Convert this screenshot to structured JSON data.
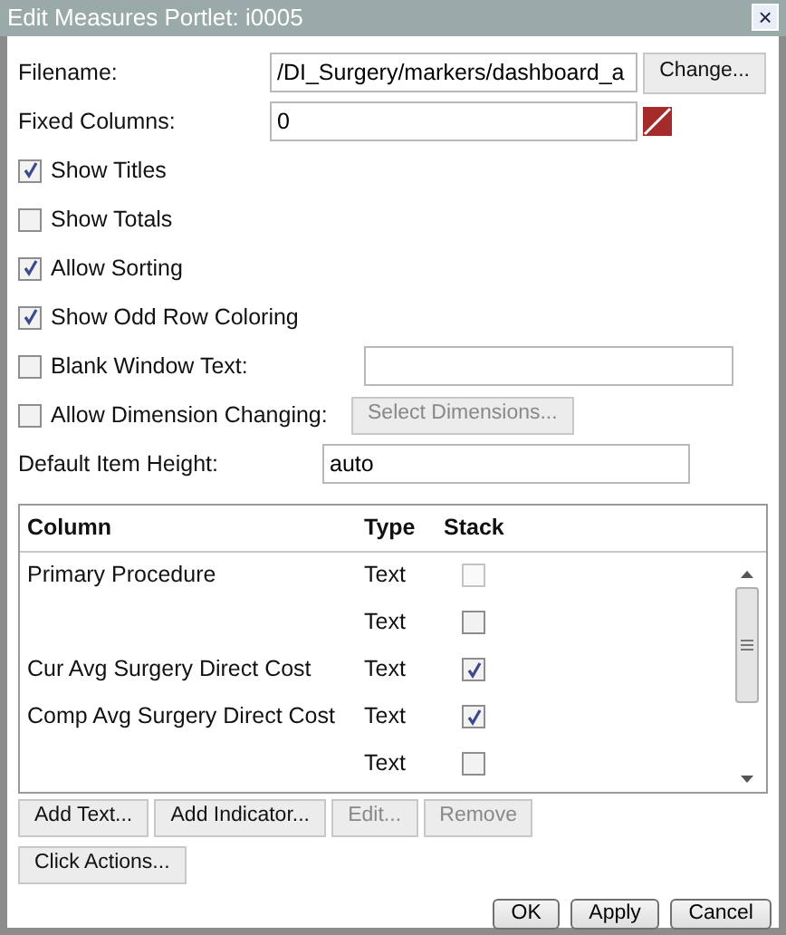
{
  "window": {
    "title": "Edit Measures Portlet: i0005",
    "close": "×"
  },
  "fields": [
    {
      "kind": "file",
      "label": "Filename:",
      "value": "/DI_Surgery/markers/dashboard_a",
      "button": "Change..."
    },
    {
      "kind": "color",
      "label": "Fixed Columns:",
      "value": "0"
    }
  ],
  "options": [
    {
      "label": "Show Titles",
      "checked": true
    },
    {
      "label": "Show Totals",
      "checked": false
    },
    {
      "label": "Allow Sorting",
      "checked": true
    },
    {
      "label": "Show Odd Row Coloring",
      "checked": true
    },
    {
      "label": "Blank Window Text:",
      "checked": false,
      "kind": "input"
    },
    {
      "label": "Allow Dimension Changing:",
      "checked": false,
      "kind": "button",
      "button": "Select Dimensions...",
      "button_disabled": true
    }
  ],
  "item_height": {
    "label": "Default Item Height:",
    "value": "auto"
  },
  "table": {
    "columns": [
      "Column",
      "Type",
      "Stack"
    ],
    "rows": [
      {
        "column": "Primary Procedure",
        "type": "Text",
        "stack": false,
        "disabled": true
      },
      {
        "type": "Text",
        "stack": false,
        "disabled": false
      },
      {
        "column": "Cur Avg Surgery Direct Cost",
        "type": "Text",
        "stack": true,
        "disabled": false
      },
      {
        "column": "Comp Avg Surgery Direct Cost",
        "type": "Text",
        "stack": true,
        "disabled": false
      },
      {
        "type": "Text",
        "stack": false,
        "disabled": false
      }
    ]
  },
  "table_buttons": [
    {
      "label": "Add Text...",
      "disabled": false
    },
    {
      "label": "Add Indicator...",
      "disabled": false
    },
    {
      "label": "Edit...",
      "disabled": true
    },
    {
      "label": "Remove",
      "disabled": true
    }
  ],
  "extra_buttons": [
    {
      "label": "Click Actions...",
      "disabled": false
    }
  ],
  "dialog_buttons": [
    "OK",
    "Apply",
    "Cancel"
  ]
}
